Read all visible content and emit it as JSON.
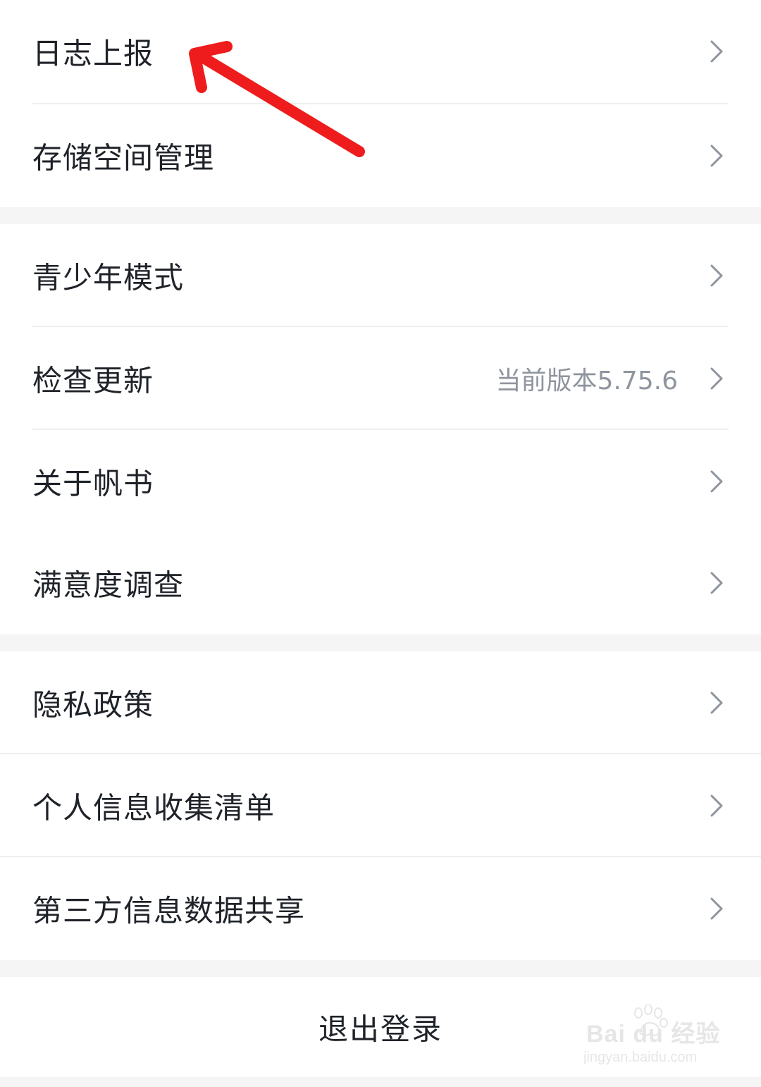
{
  "menu": {
    "group1": [
      {
        "label": "日志上报"
      },
      {
        "label": "存储空间管理"
      }
    ],
    "group2": [
      {
        "label": "青少年模式"
      },
      {
        "label": "检查更新",
        "value": "当前版本5.75.6"
      },
      {
        "label": "关于帆书"
      },
      {
        "label": "满意度调查"
      }
    ],
    "group3": [
      {
        "label": "隐私政策"
      },
      {
        "label": "个人信息收集清单"
      },
      {
        "label": "第三方信息数据共享"
      }
    ]
  },
  "logout_label": "退出登录",
  "annotation": {
    "color": "#ee1c1c"
  },
  "icons": {
    "row_chevron": "chevron-right-icon"
  },
  "watermark": {
    "brand": "Bai du 经验",
    "url": "jingyan.baidu.com"
  }
}
